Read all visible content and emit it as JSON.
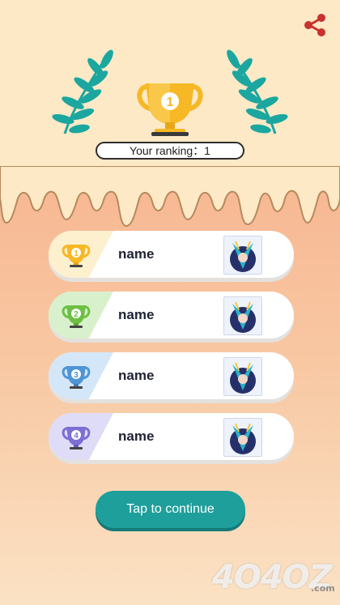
{
  "header": {
    "share_icon": "share-icon",
    "ranking_label": "Your ranking：",
    "ranking_value": "1",
    "top_trophy_number": "1"
  },
  "ranks": [
    {
      "position": "1",
      "name": "name",
      "color": "#f6b825",
      "tint": "#fdf0cf"
    },
    {
      "position": "2",
      "name": "name",
      "color": "#6dc043",
      "tint": "#d8f1cc"
    },
    {
      "position": "3",
      "name": "name",
      "color": "#4e95d6",
      "tint": "#d4e7f8"
    },
    {
      "position": "4",
      "name": "name",
      "color": "#7c6ed4",
      "tint": "#dfdcf8"
    }
  ],
  "continue_label": "Tap to continue",
  "watermark": {
    "text": "4O4OZ",
    "sub": ".com"
  },
  "colors": {
    "accent": "#1e9f9b",
    "leaf": "#1ba7a0",
    "gold": "#f6b825"
  }
}
